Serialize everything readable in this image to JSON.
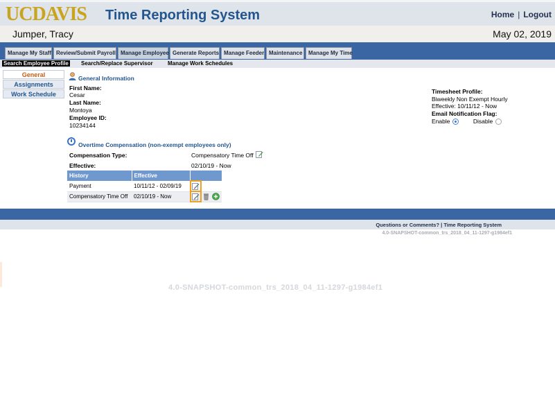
{
  "header": {
    "logo": "UCDAVIS",
    "title": "Time Reporting System",
    "home_link": "Home",
    "separator": "|",
    "logout_link": "Logout"
  },
  "userbar": {
    "name": "Jumper, Tracy",
    "date": "May 02, 2019"
  },
  "tabs": [
    {
      "label": "Manage My Staff"
    },
    {
      "label": "Review/Submit Payroll"
    },
    {
      "label": "Manage Employee"
    },
    {
      "label": "Generate Reports"
    },
    {
      "label": "Manage Feeder"
    },
    {
      "label": "Maintenance"
    },
    {
      "label": "Manage My Time"
    }
  ],
  "subnav": [
    {
      "label": "Search Employee Profile"
    },
    {
      "label": "Search/Replace Supervisor"
    },
    {
      "label": "Manage Work Schedules"
    }
  ],
  "leftnav": [
    {
      "label": "General"
    },
    {
      "label": "Assignments"
    },
    {
      "label": "Work Schedule"
    }
  ],
  "general": {
    "title": "General Information",
    "first_name_label": "First Name:",
    "first_name": "Cesar",
    "last_name_label": "Last Name:",
    "last_name": "Montoya",
    "employee_id_label": "Employee ID:",
    "employee_id": "10234144"
  },
  "timesheet": {
    "profile_label": "Timesheet Profile:",
    "profile": "Biweekly Non Exempt Hourly",
    "effective": "Effective: 10/11/12 - Now",
    "email_flag_label": "Email Notification Flag:",
    "enable_label": "Enable",
    "disable_label": "Disable",
    "selected": "Enable"
  },
  "overtime": {
    "title": "Overtime Compensation (non-exempt employees only)",
    "comp_type_label": "Compensation Type:",
    "comp_type": "Compensatory Time Off",
    "effective_label": "Effective:",
    "effective": "02/10/19 - Now",
    "history_header": "History",
    "effective_header": "Effective",
    "rows": [
      {
        "type": "Payment",
        "range": "10/11/12 - 02/09/19"
      },
      {
        "type": "Compensatory Time Off",
        "range": "02/10/19 - Now"
      }
    ]
  },
  "footer": {
    "questions": "Questions or Comments?",
    "separator": "|",
    "system": "Time Reporting System",
    "version": "4.0-SNAPSHOT-common_trs_2018_04_11-1297-g1984ef1",
    "ghost_version": "4.0-SNAPSHOT-common_trs_2018_04_11-1297-g1984ef1"
  },
  "colors": {
    "brand_gold": "#c9a41f",
    "brand_blue": "#23568e",
    "nav_blue": "#3a66a3",
    "highlight": "#f0a020"
  }
}
